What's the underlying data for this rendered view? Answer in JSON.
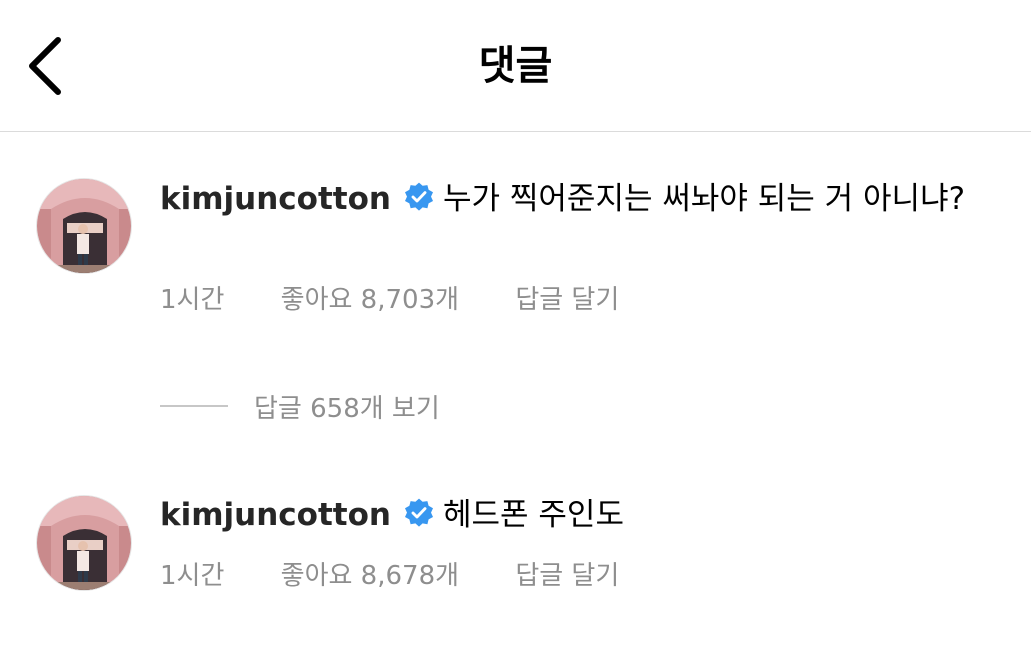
{
  "header": {
    "title": "댓글",
    "back_icon": "chevron-left-icon"
  },
  "comments": [
    {
      "username": "kimjuncotton",
      "verified_icon": "verified-badge-icon",
      "text": "누가 찍어준지는 써놔야 되는 거 아니냐?",
      "time": "1시간",
      "likes": "좋아요 8,703개",
      "reply_label": "답글 달기"
    },
    {
      "username": "kimjuncotton",
      "verified_icon": "verified-badge-icon",
      "text": "헤드폰 주인도",
      "time": "1시간",
      "likes": "좋아요 8,678개",
      "reply_label": "답글 달기"
    }
  ],
  "view_replies": {
    "label": "답글 658개 보기"
  },
  "colors": {
    "verified": "#3897f0",
    "meta_text": "#8e8e8e",
    "divider": "#dbdbdb"
  }
}
